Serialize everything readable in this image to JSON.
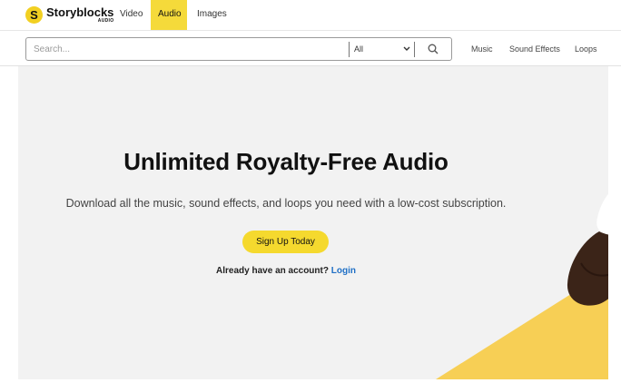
{
  "brand": {
    "name": "Storyblocks",
    "sub": "AUDIO",
    "logo_letter": "S",
    "color": "#f2d022"
  },
  "nav": {
    "items": [
      {
        "label": "Video",
        "active": false
      },
      {
        "label": "Audio",
        "active": true
      },
      {
        "label": "Images",
        "active": false
      }
    ]
  },
  "search": {
    "placeholder": "Search...",
    "value": "",
    "scope_selected": "All",
    "icon": "search-icon"
  },
  "subnav": {
    "items": [
      {
        "label": "Music"
      },
      {
        "label": "Sound Effects"
      },
      {
        "label": "Loops"
      }
    ]
  },
  "hero": {
    "title": "Unlimited Royalty-Free Audio",
    "subtitle": "Download all the music, sound effects, and loops you need with a low-cost subscription.",
    "cta": "Sign Up Today",
    "login_prompt": "Already have an account?",
    "login_link": "Login"
  },
  "colors": {
    "accent": "#f5d92e",
    "link": "#1f6fc5",
    "hero_bg": "#f2f2f2"
  }
}
